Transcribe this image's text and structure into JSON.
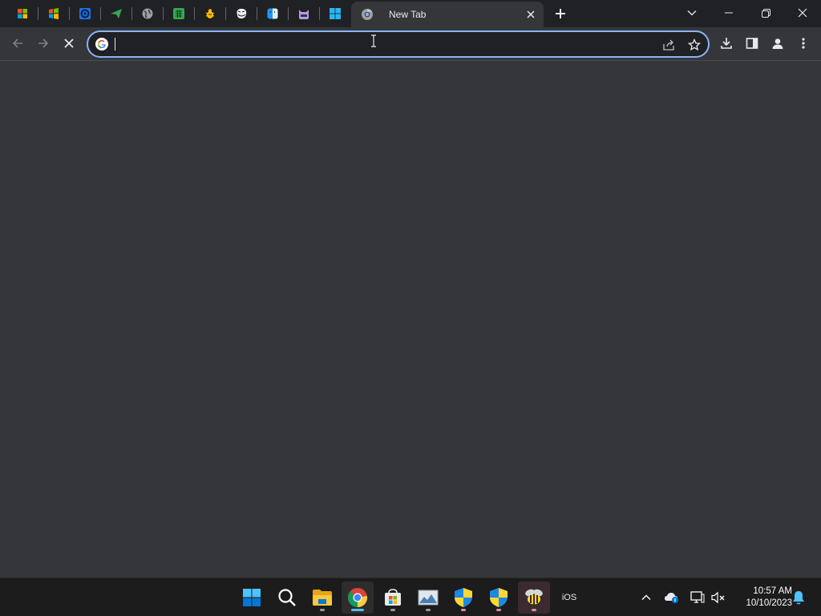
{
  "browser": {
    "pinned_tabs": [
      {
        "icon": "windows-legacy-icon"
      },
      {
        "icon": "windows-xp-icon"
      },
      {
        "icon": "settings-app-icon"
      },
      {
        "icon": "paper-plane-icon"
      },
      {
        "icon": "globe-icon"
      },
      {
        "icon": "spreadsheet-icon"
      },
      {
        "icon": "bug-icon"
      },
      {
        "icon": "troll-face-icon"
      },
      {
        "icon": "finder-icon"
      },
      {
        "icon": "cat-icon"
      },
      {
        "icon": "windows-11-icon"
      }
    ],
    "active_tab": {
      "title": "New Tab",
      "icon": "chrome-new-tab-icon"
    },
    "toolbar": {
      "back_icon": "arrow-left-icon",
      "forward_icon": "arrow-right-icon",
      "stop_icon": "close-icon"
    },
    "omnibox": {
      "value": "",
      "placeholder": "",
      "engine_icon": "google-icon"
    },
    "accent": "#8ab4f8"
  },
  "taskbar": {
    "apps": [
      {
        "icon": "start-icon"
      },
      {
        "icon": "search-icon"
      },
      {
        "icon": "file-explorer-icon"
      },
      {
        "icon": "chrome-icon"
      },
      {
        "icon": "microsoft-store-icon"
      },
      {
        "icon": "photos-icon"
      },
      {
        "icon": "security-shield-icon"
      },
      {
        "icon": "security-shield-icon"
      },
      {
        "icon": "bee-icon"
      },
      {
        "label": "iOS"
      }
    ],
    "clock": {
      "time": "10:57 AM",
      "date": "10/10/2023"
    }
  }
}
